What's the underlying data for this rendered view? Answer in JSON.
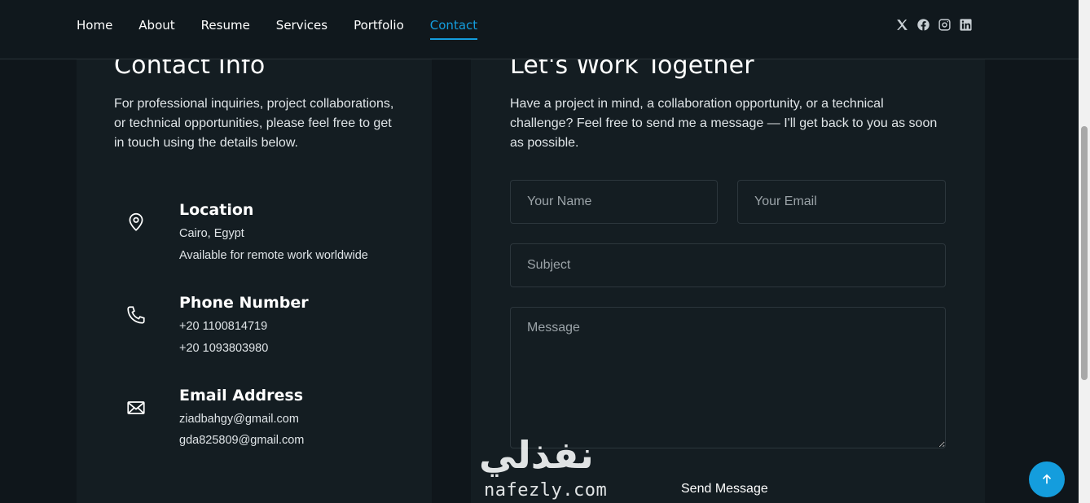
{
  "nav": {
    "items": [
      {
        "label": "Home"
      },
      {
        "label": "About"
      },
      {
        "label": "Resume"
      },
      {
        "label": "Services"
      },
      {
        "label": "Portfolio"
      },
      {
        "label": "Contact",
        "active": true
      }
    ],
    "social_icons": [
      "x-icon",
      "facebook-icon",
      "instagram-icon",
      "linkedin-icon"
    ]
  },
  "contact_info": {
    "title": "Contact Info",
    "description": "For professional inquiries, project collaborations, or technical opportunities, please feel free to get in touch using the details below.",
    "location": {
      "icon": "map-pin-icon",
      "heading": "Location",
      "lines": [
        "Cairo, Egypt",
        "Available for remote work worldwide"
      ]
    },
    "phone": {
      "icon": "phone-icon",
      "heading": "Phone Number",
      "lines": [
        "+20 1100814719",
        "+20 1093803980"
      ]
    },
    "email": {
      "icon": "envelope-icon",
      "heading": "Email Address",
      "lines": [
        "ziadbahgy@gmail.com",
        "gda825809@gmail.com"
      ]
    }
  },
  "form": {
    "title": "Let's Work Together",
    "description": "Have a project in mind, a collaboration opportunity, or a technical challenge? Feel free to send me a message — I'll get back to you as soon as possible.",
    "name_placeholder": "Your Name",
    "email_placeholder": "Your Email",
    "subject_placeholder": "Subject",
    "message_placeholder": "Message",
    "submit_label": "Send Message"
  },
  "watermark": {
    "arabic": "نفذلي",
    "latin": "nafezly.com"
  },
  "colors": {
    "accent": "#149ddd",
    "background": "#0f161b",
    "card": "#141d22"
  }
}
